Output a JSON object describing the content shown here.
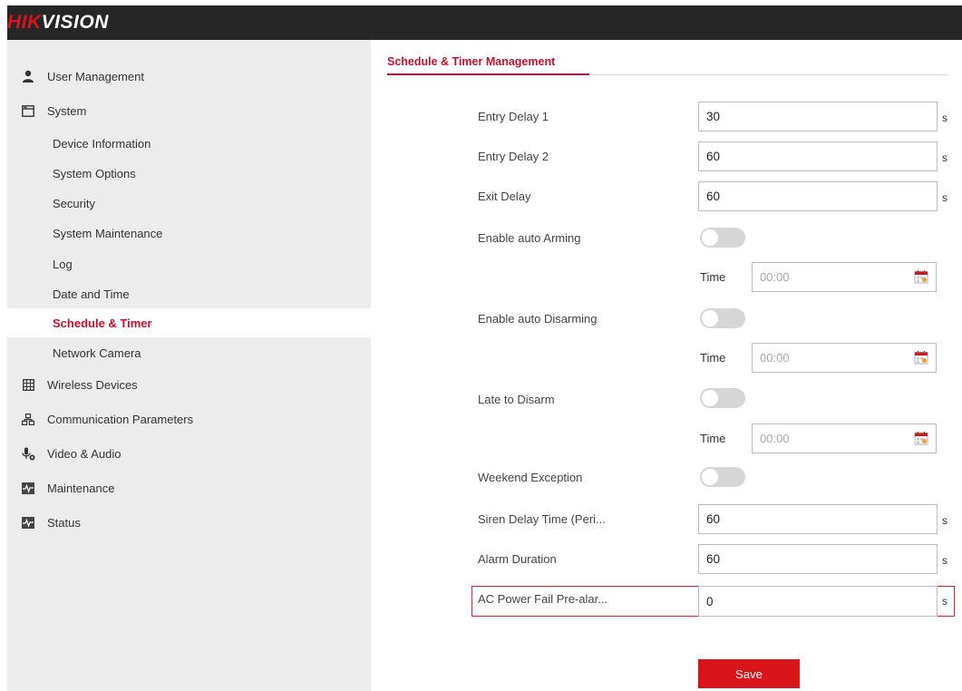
{
  "brand": {
    "logo_red": "HIK",
    "logo_white": "VISION"
  },
  "sidebar": {
    "groups": [
      {
        "label": "User Management",
        "icon": "user-icon"
      },
      {
        "label": "System",
        "icon": "window-icon"
      },
      {
        "label": "Wireless Devices",
        "icon": "grid-icon"
      },
      {
        "label": "Communication Parameters",
        "icon": "network-icon"
      },
      {
        "label": "Video & Audio",
        "icon": "microphone-icon"
      },
      {
        "label": "Maintenance",
        "icon": "pulse-icon"
      },
      {
        "label": "Status",
        "icon": "pulse-icon"
      }
    ],
    "system_items": [
      "Device Information",
      "System Options",
      "Security",
      "System Maintenance",
      "Log",
      "Date and Time",
      "Schedule & Timer",
      "Network Camera"
    ],
    "active_item": "Schedule & Timer"
  },
  "main": {
    "tab": "Schedule & Timer Management",
    "unit": "s",
    "fields": {
      "entry_delay_1": {
        "label": "Entry Delay 1",
        "value": "30"
      },
      "entry_delay_2": {
        "label": "Entry Delay 2",
        "value": "60"
      },
      "exit_delay": {
        "label": "Exit Delay",
        "value": "60"
      },
      "auto_arming": {
        "label": "Enable auto Arming",
        "enabled": false,
        "time_label": "Time",
        "time_placeholder": "00:00"
      },
      "auto_disarming": {
        "label": "Enable auto Disarming",
        "enabled": false,
        "time_label": "Time",
        "time_placeholder": "00:00"
      },
      "late_to_disarm": {
        "label": "Late to Disarm",
        "enabled": false,
        "time_label": "Time",
        "time_placeholder": "00:00"
      },
      "weekend_exception": {
        "label": "Weekend Exception",
        "enabled": false
      },
      "siren_delay": {
        "label": "Siren Delay Time (Peri...",
        "value": "60"
      },
      "alarm_duration": {
        "label": "Alarm Duration",
        "value": "60"
      },
      "ac_power_fail": {
        "label": "AC Power Fail Pre-alar...",
        "value": "0"
      }
    },
    "save_label": "Save"
  },
  "colors": {
    "accent": "#c8102e",
    "header_bg": "#262626",
    "sidebar_bg": "#ececec",
    "toggle_off": "#d6d6d6"
  }
}
